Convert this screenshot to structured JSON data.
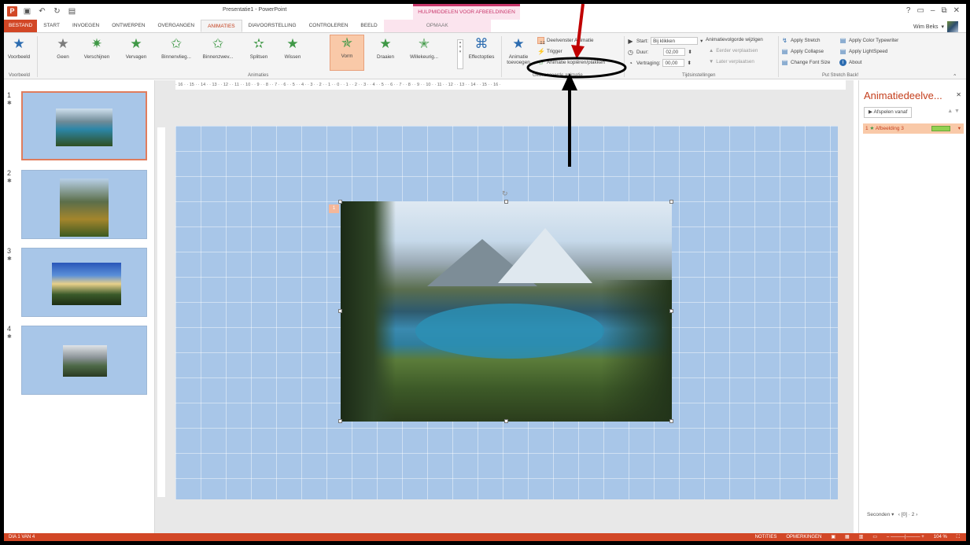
{
  "titlebar": {
    "doc_title": "Presentatie1 - PowerPoint",
    "context_label": "HULPMIDDELEN VOOR AFBEELDINGEN",
    "help": "?",
    "user": "Wim Beks"
  },
  "tabs": {
    "file": "BESTAND",
    "start": "START",
    "insert": "INVOEGEN",
    "design": "ONTWERPEN",
    "transitions": "OVERGANGEN",
    "animations": "ANIMATIES",
    "slideshow": "DIAVOORSTELLING",
    "review": "CONTROLEREN",
    "view": "BEELD",
    "format": "OPMAAK"
  },
  "ribbon": {
    "preview": "Voorbeeld",
    "preview_group": "Voorbeeld",
    "animations_group": "Animaties",
    "advanced_group": "Geavanceerde animatie",
    "timing_group": "Tijdsinstellingen",
    "stretch_group": "Put Stretch Back!",
    "effects": [
      "Geen",
      "Verschijnen",
      "Vervagen",
      "Binnenvlieg...",
      "Binnenzwev...",
      "Splitsen",
      "Wissen",
      "Vorm",
      "Draaien",
      "Willekeurig..."
    ],
    "effect_options": "Effectopties",
    "add_animation": "Animatie toevoegen",
    "pane": "Deelvenster Animatie",
    "trigger": "Trigger",
    "painter": "Animatie kopiëren/plakken",
    "start_label": "Start:",
    "start_value": "Bij klikken",
    "duration_label": "Duur:",
    "duration_value": "02,00",
    "delay_label": "Vertraging:",
    "delay_value": "00,00",
    "reorder": "Animatievolgorde wijzigen",
    "move_earlier": "Eerder verplaatsen",
    "move_later": "Later verplaatsen",
    "apply_stretch": "Apply Stretch",
    "apply_collapse": "Apply Collapse",
    "change_font": "Change Font Size",
    "apply_typewriter": "Apply Color Typewriter",
    "apply_lightspeed": "Apply LightSpeed",
    "about": "About"
  },
  "ruler": "· 16 · · 15 · · 14 · · 13 · · 12 · · 11 · · 10 · · 9 · · 8 · · 7 · · 6 · · 5 · · 4 · · 3 · · 2 · · 1 · · 0 · · 1 · · 2 · · 3 · · 4 · · 5 · · 6 · · 7 · · 8 · · 9 · · 10 · · 11 · · 12 · · 13 · · 14 · · 15 · · 16 ·",
  "slides": [
    {
      "num": "1"
    },
    {
      "num": "2"
    },
    {
      "num": "3"
    },
    {
      "num": "4"
    }
  ],
  "canvas": {
    "anim_tag": "1"
  },
  "animpane": {
    "title": "Animatiedeelve...",
    "play": "Afspelen vanaf",
    "item_num": "1",
    "item_label": "Afbeelding 3",
    "seconds": "Seconden",
    "sec_from": "0",
    "sec_to": "2"
  },
  "statusbar": {
    "slide": "DIA 1 VAN 4",
    "notes": "NOTITIES",
    "comments": "OPMERKINGEN",
    "zoom": "104 %"
  },
  "colors": {
    "accent": "#d24726",
    "annotation_red": "#c00000",
    "slide_bg": "#a8c6e8"
  }
}
